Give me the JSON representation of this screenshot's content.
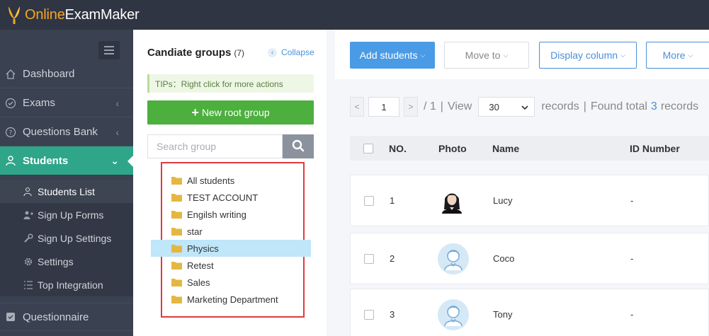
{
  "app": {
    "brand_prefix": "Online",
    "brand_suffix": "ExamMaker",
    "brand_color": "#f5a623"
  },
  "sidebar": {
    "items": [
      {
        "label": "Dashboard",
        "icon": "home-icon"
      },
      {
        "label": "Exams",
        "icon": "check-circle-icon"
      },
      {
        "label": "Questions Bank",
        "icon": "question-circle-icon"
      },
      {
        "label": "Students",
        "icon": "students-icon",
        "active": true
      },
      {
        "label": "Questionnaire",
        "icon": "checkbox-icon"
      }
    ],
    "sub_items": [
      {
        "label": "Students List",
        "icon": "user-list-icon",
        "active": true
      },
      {
        "label": "Sign Up Forms",
        "icon": "user-plus-icon"
      },
      {
        "label": "Sign Up Settings",
        "icon": "wrench-icon"
      },
      {
        "label": "Settings",
        "icon": "gear-icon"
      },
      {
        "label": "Top Integration",
        "icon": "list-icon"
      }
    ],
    "active_color": "#2fa689"
  },
  "groups": {
    "title": "Candiate groups",
    "count": "(7)",
    "collapse_label": "Collapse",
    "tips": "TIPs：Right click for more actions",
    "new_root_label": "New root group",
    "search_placeholder": "Search group",
    "items": [
      {
        "label": "All students"
      },
      {
        "label": "TEST ACCOUNT"
      },
      {
        "label": "Engilsh writing"
      },
      {
        "label": "star"
      },
      {
        "label": "Physics",
        "selected": true
      },
      {
        "label": "Retest"
      },
      {
        "label": "Sales"
      },
      {
        "label": "Marketing Department"
      }
    ]
  },
  "toolbar": {
    "add_students": "Add students",
    "move_to": "Move to",
    "display_column": "Display column",
    "more": "More"
  },
  "pager": {
    "prev": "<",
    "next": ">",
    "page": "1",
    "total_pages": "/ 1",
    "sep1": "|",
    "view_label": "View",
    "page_size": "30",
    "records_label": "records",
    "sep2": "|",
    "found_prefix": "Found total",
    "found_count": "3",
    "found_suffix": "records"
  },
  "table": {
    "columns": [
      "NO.",
      "Photo",
      "Name",
      "ID Number"
    ],
    "rows": [
      {
        "no": "1",
        "photo": "photo",
        "name": "Lucy",
        "id_number": "-"
      },
      {
        "no": "2",
        "photo": "default-avatar",
        "name": "Coco",
        "id_number": "-"
      },
      {
        "no": "3",
        "photo": "default-avatar",
        "name": "Tony",
        "id_number": "-"
      }
    ]
  }
}
